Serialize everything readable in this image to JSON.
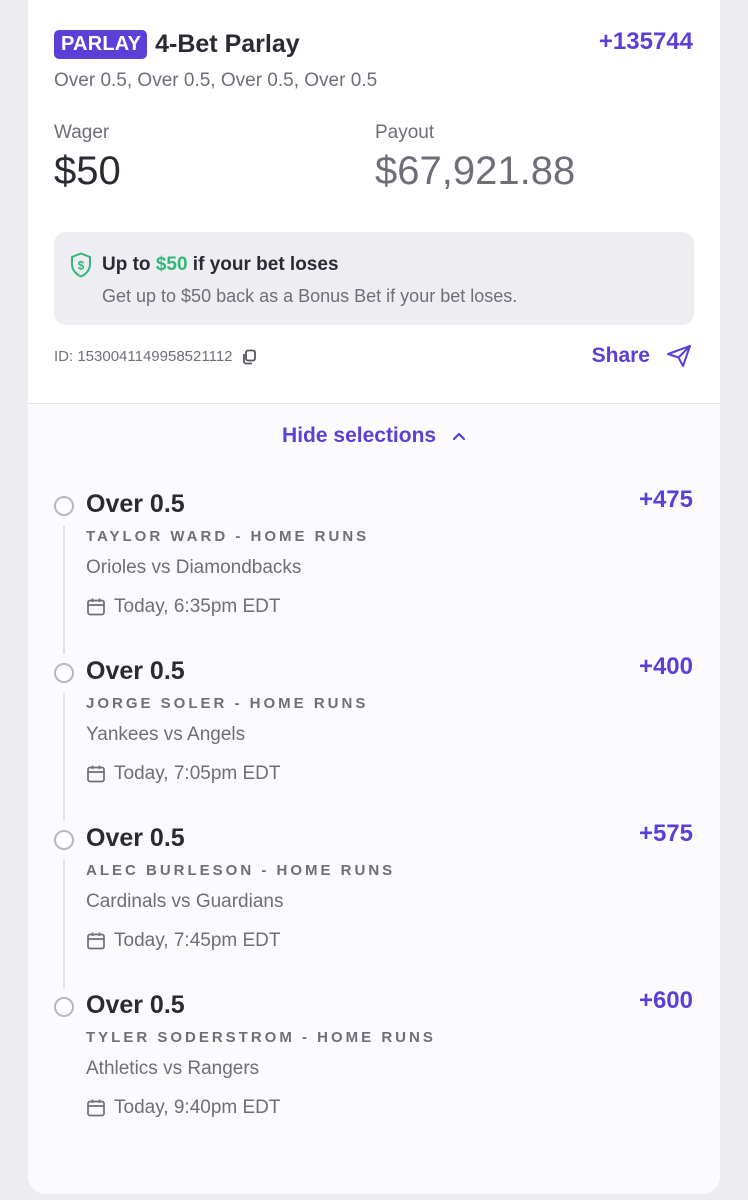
{
  "bet": {
    "badge": "PARLAY",
    "title": "4-Bet Parlay",
    "total_odds": "+135744",
    "subtitle": "Over 0.5, Over 0.5, Over 0.5, Over 0.5",
    "wager_label": "Wager",
    "wager_value": "$50",
    "payout_label": "Payout",
    "payout_value": "$67,921.88"
  },
  "promo": {
    "icon": "shield-dollar-icon",
    "line1_prefix": "Up to ",
    "line1_amount": "$50",
    "line1_suffix": " if your bet loses",
    "line2": "Get up to $50 back as a Bonus Bet if your bet loses."
  },
  "meta": {
    "bet_id": "ID: 1530041149958521112",
    "share_label": "Share"
  },
  "selections_toggle": "Hide selections",
  "legs": [
    {
      "selection": "Over 0.5",
      "odds": "+475",
      "market": "TAYLOR WARD - HOME RUNS",
      "game": "Orioles vs Diamondbacks",
      "time": "Today, 6:35pm EDT"
    },
    {
      "selection": "Over 0.5",
      "odds": "+400",
      "market": "JORGE SOLER - HOME RUNS",
      "game": "Yankees vs Angels",
      "time": "Today, 7:05pm EDT"
    },
    {
      "selection": "Over 0.5",
      "odds": "+575",
      "market": "ALEC BURLESON - HOME RUNS",
      "game": "Cardinals vs Guardians",
      "time": "Today, 7:45pm EDT"
    },
    {
      "selection": "Over 0.5",
      "odds": "+600",
      "market": "TYLER SODERSTROM - HOME RUNS",
      "game": "Athletics vs Rangers",
      "time": "Today, 9:40pm EDT"
    }
  ],
  "colors": {
    "accent": "#5b3fd6",
    "promo_green": "#2fb877",
    "muted_text": "#6e6e78"
  }
}
